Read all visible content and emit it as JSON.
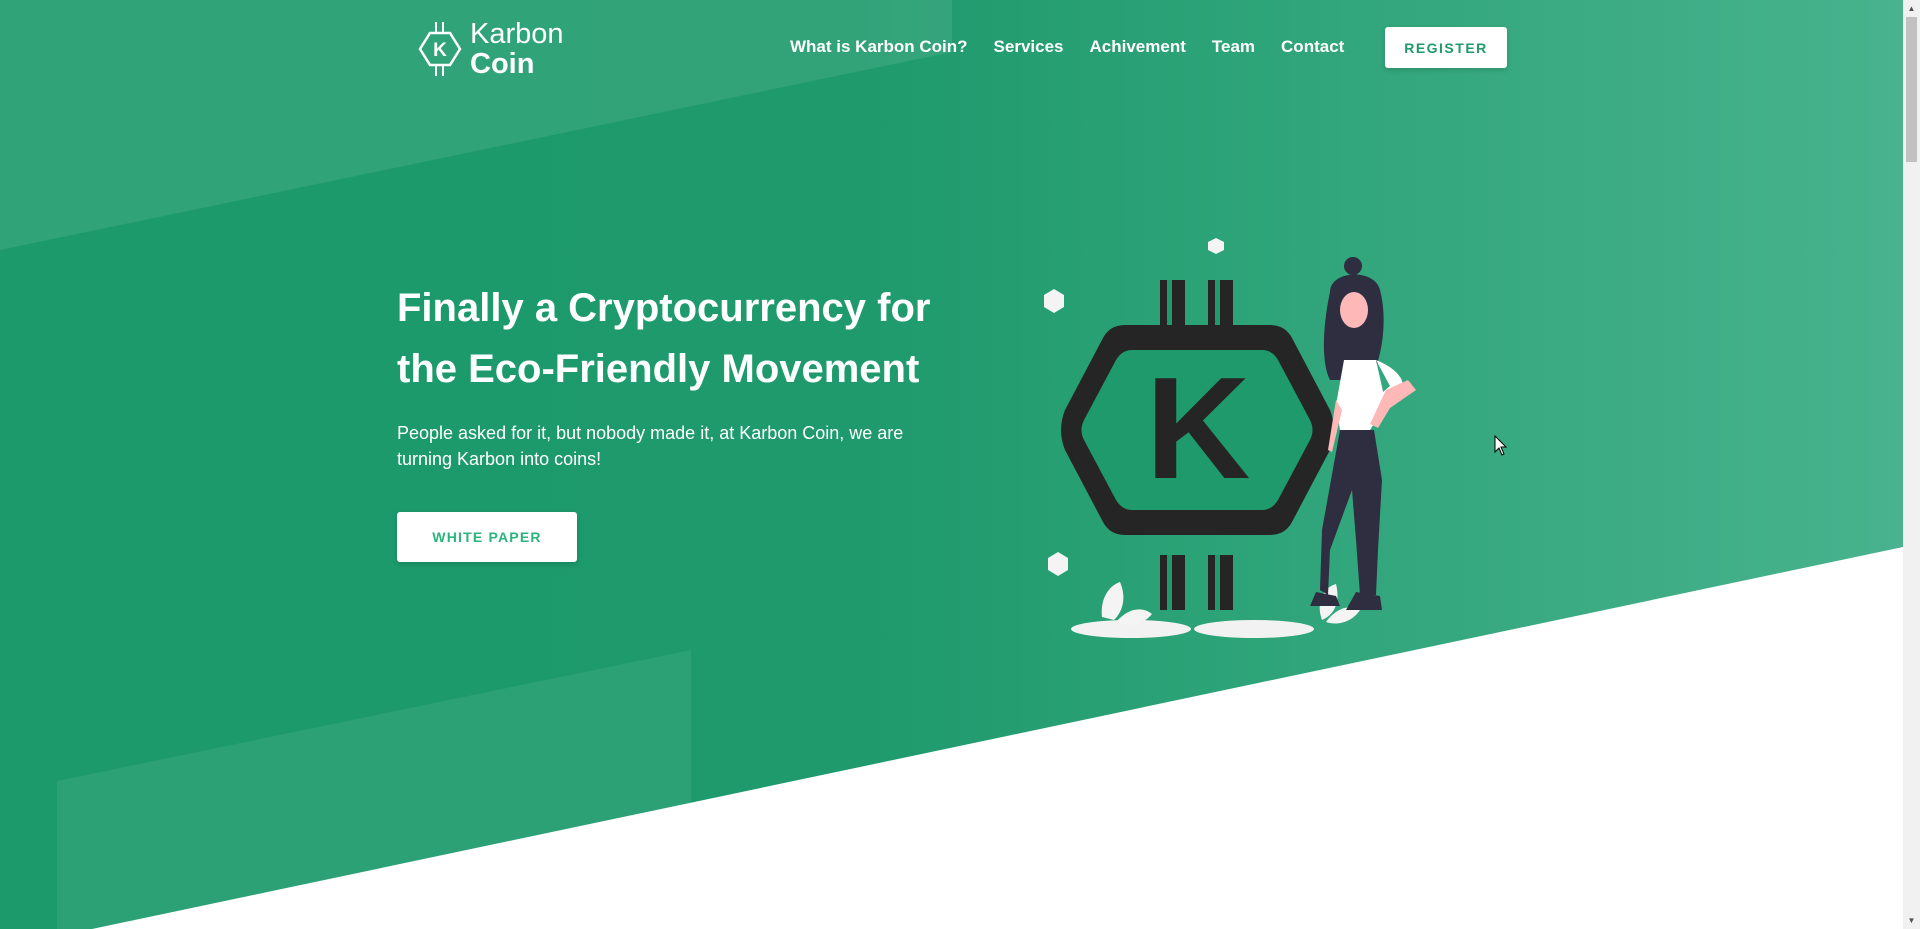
{
  "brand": {
    "name_light": "Karbon",
    "name_bold": "Coin",
    "logo_letter": "K"
  },
  "nav": {
    "links": [
      {
        "label": "What is Karbon Coin?"
      },
      {
        "label": "Services"
      },
      {
        "label": "Achivement"
      },
      {
        "label": "Team"
      },
      {
        "label": "Contact"
      }
    ],
    "register_label": "REGISTER"
  },
  "hero": {
    "headline": "Finally a Cryptocurrency for the Eco-Friendly Movement",
    "subtext": "People asked for it, but nobody made it, at Karbon Coin, we are turning Karbon into coins!",
    "cta_label": "WHITE PAPER",
    "illustration_letter": "K"
  },
  "colors": {
    "primary_green": "#1e9a6b",
    "light_green": "#4fb892",
    "cta_text": "#2bb37d",
    "white": "#ffffff",
    "dark": "#252525"
  },
  "icons": {
    "logo": "hexagon-k-coin-icon",
    "cursor": "mouse-pointer-icon",
    "scroll_up": "triangle-up-icon",
    "scroll_down": "triangle-down-icon"
  }
}
